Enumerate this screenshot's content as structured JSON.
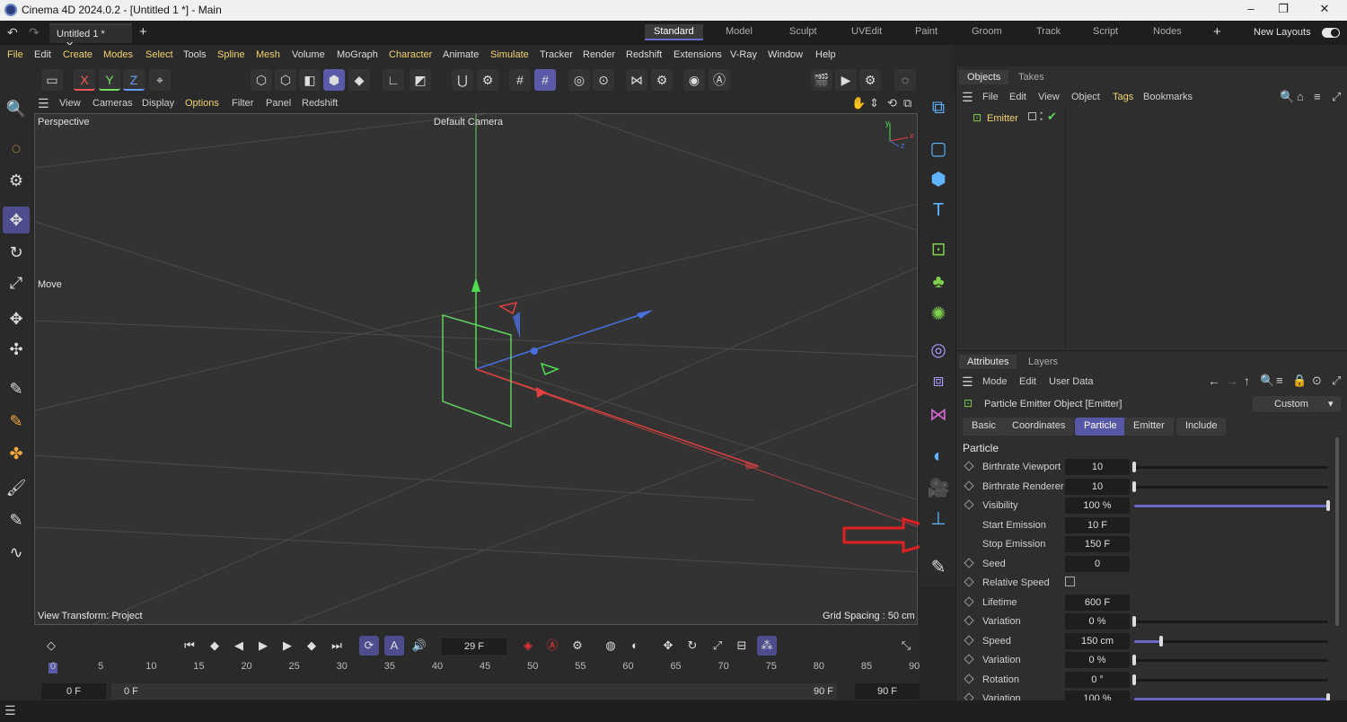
{
  "window": {
    "title": "Cinema 4D 2024.0.2 - [Untitled 1 *] - Main",
    "doc_tab": "Untitled 1 *",
    "layouts": [
      "Standard",
      "Model",
      "Sculpt",
      "UVEdit",
      "Paint",
      "Groom",
      "Track",
      "Script",
      "Nodes"
    ],
    "active_layout": "Standard",
    "new_layouts": "New Layouts"
  },
  "menu": [
    "File",
    "Edit",
    "Create",
    "Modes",
    "Select",
    "Tools",
    "Spline",
    "Mesh",
    "Volume",
    "MoGraph",
    "Character",
    "Animate",
    "Simulate",
    "Tracker",
    "Render",
    "Redshift",
    "Extensions",
    "V-Ray",
    "Window",
    "Help"
  ],
  "axis": {
    "x": "X",
    "y": "Y",
    "z": "Z"
  },
  "viewport": {
    "menu": [
      "View",
      "Cameras",
      "Display",
      "Options",
      "Filter",
      "Panel",
      "Redshift"
    ],
    "name": "Perspective",
    "camera": "Default Camera",
    "tool_label": "Move",
    "view_transform": "View Transform: Project",
    "grid_spacing": "Grid Spacing : 50 cm",
    "axis_y": "y",
    "axis_z": "z",
    "axis_x": "x"
  },
  "objects": {
    "tabs": [
      "Objects",
      "Takes"
    ],
    "menu": [
      "File",
      "Edit",
      "View",
      "Object",
      "Tags",
      "Bookmarks"
    ],
    "items": [
      {
        "name": "Emitter"
      }
    ]
  },
  "attributes": {
    "tabs": [
      "Attributes",
      "Layers"
    ],
    "menu": [
      "Mode",
      "Edit",
      "User Data"
    ],
    "object_title": "Particle Emitter Object [Emitter]",
    "preset": "Custom",
    "sections": [
      "Basic",
      "Coordinates",
      "Particle",
      "Emitter",
      "Include"
    ],
    "active_section": "Particle",
    "group_title": "Particle",
    "params": [
      {
        "label": "Birthrate Viewport",
        "value": "10",
        "slider": 0.0
      },
      {
        "label": "Birthrate Renderer",
        "value": "10",
        "slider": 0.0
      },
      {
        "label": "Visibility",
        "value": "100 %",
        "slider": 1.0
      },
      {
        "label": "Start Emission",
        "value": "10 F"
      },
      {
        "label": "Stop Emission",
        "value": "150 F"
      },
      {
        "label": "Seed",
        "value": "0"
      },
      {
        "label": "Relative Speed",
        "checkbox": false
      },
      {
        "label": "Lifetime",
        "value": "600 F"
      },
      {
        "label": "Variation",
        "value": "0 %",
        "slider": 0.0
      },
      {
        "label": "Speed",
        "value": "150 cm",
        "slider": 0.14
      },
      {
        "label": "Variation",
        "value": "0 %",
        "slider": 0.0
      },
      {
        "label": "Rotation",
        "value": "0 °",
        "slider": 0.0
      },
      {
        "label": "Variation",
        "value": "100 %",
        "slider": 1.0
      }
    ]
  },
  "timeline": {
    "current_frame": "29 F",
    "ticks": [
      "0",
      "5",
      "10",
      "15",
      "20",
      "25",
      "30",
      "35",
      "40",
      "45",
      "50",
      "55",
      "60",
      "65",
      "70",
      "75",
      "80",
      "85",
      "90"
    ],
    "start": "0 F",
    "range_start": "0 F",
    "range_end": "90 F",
    "end": "90 F"
  },
  "colors": {
    "accent": "#5a5aa8",
    "highlight_text": "#f3d36b",
    "icon_blue": "#5fb3ff",
    "annotation": "#e02020"
  }
}
